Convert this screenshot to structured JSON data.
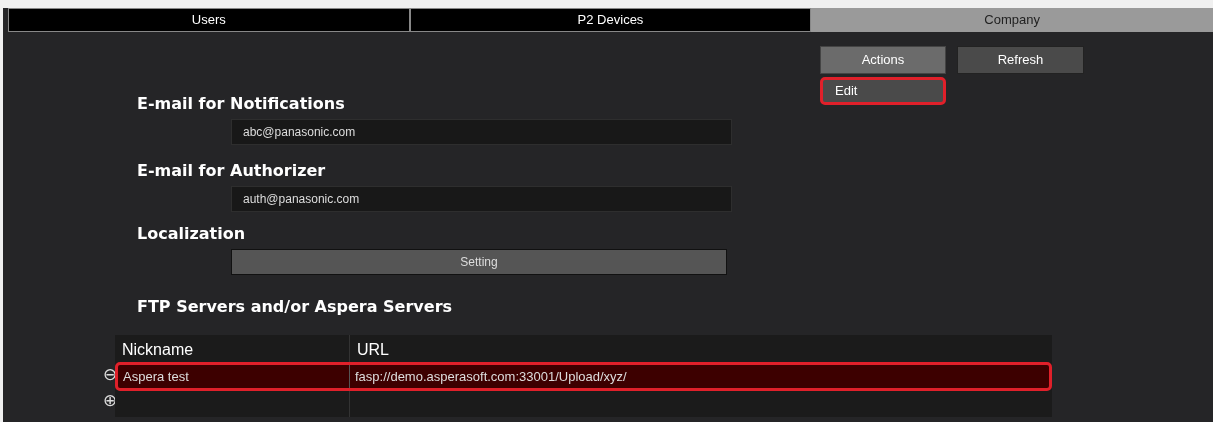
{
  "tabs": [
    {
      "label": "Users",
      "selected": false
    },
    {
      "label": "P2 Devices",
      "selected": false
    },
    {
      "label": "Company",
      "selected": true
    }
  ],
  "toolbar": {
    "buttons": [
      "Actions",
      "Refresh"
    ],
    "menu": [
      {
        "label": "Edit",
        "selected": true
      }
    ]
  },
  "sections": [
    {
      "title": "E-mail for Notifications",
      "kind": "field",
      "value": "abc@panasonic.com"
    },
    {
      "title": "E-mail for Authorizer",
      "kind": "field",
      "value": "auth@panasonic.com"
    },
    {
      "title": "Localization",
      "kind": "button",
      "value": "Setting"
    },
    {
      "title": "FTP Servers and/or Aspera Servers",
      "kind": "table"
    }
  ],
  "table": {
    "columns": [
      "Nickname",
      "URL"
    ],
    "rows": [
      {
        "cells": [
          "Aspera test",
          "fasp://demo.asperasoft.com:33001/Upload/xyz/"
        ],
        "selected": true
      }
    ],
    "remove_button": "⊖",
    "add_button": "⊕"
  }
}
